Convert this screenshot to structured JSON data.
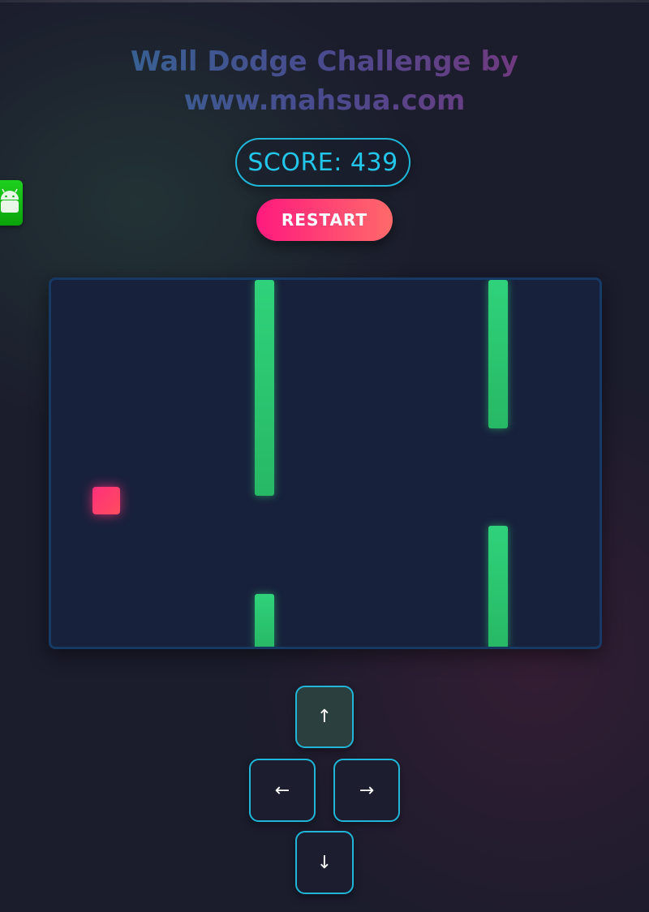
{
  "title": {
    "line1": "Wall Dodge Challenge by",
    "line2": "www.mahsua.com"
  },
  "side_tab": {
    "icon": "android-icon"
  },
  "score": {
    "label": "SCORE: 439",
    "value": 439
  },
  "restart": {
    "label": "RESTART"
  },
  "controls": {
    "up": "↑",
    "left": "←",
    "right": "→",
    "down": "↓"
  },
  "colors": {
    "accent": "#1fb6d8",
    "wall": "#2fd27a",
    "player": "#ff2f7a",
    "restart_start": "#ff1a7e",
    "restart_end": "#ff6a6a"
  }
}
